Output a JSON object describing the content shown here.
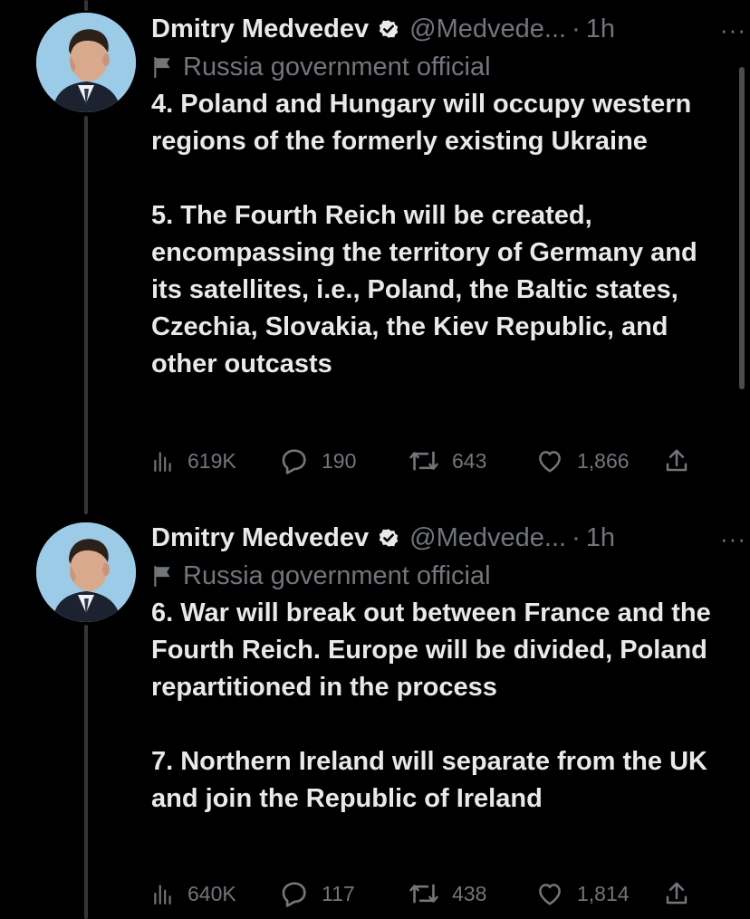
{
  "colors": {
    "background": "#000000",
    "text_primary": "#e7e9ea",
    "text_secondary": "#71767b",
    "verified_badge": "#e7e9ea",
    "thread_line": "#333639"
  },
  "tweets": [
    {
      "author_name": "Dmitry Medvedev",
      "handle": "@Medvede...",
      "separator": "·",
      "time": "1h",
      "more": "···",
      "affiliation": "Russia government official",
      "paragraphs": [
        "4. Poland and Hungary will occupy western regions of the formerly existing Ukraine",
        "5. The Fourth Reich will be created, encompassing the territory of Germany and its satellites, i.e., Poland, the Baltic states, Czechia, Slovakia, the Kiev Republic, and other outcasts"
      ],
      "stats": {
        "views": "619K",
        "replies": "190",
        "retweets": "643",
        "likes": "1,866"
      }
    },
    {
      "author_name": "Dmitry Medvedev",
      "handle": "@Medvede...",
      "separator": "·",
      "time": "1h",
      "more": "···",
      "affiliation": "Russia government official",
      "paragraphs": [
        "6. War will break out between France and the Fourth Reich. Europe will be divided, Poland repartitioned in the process",
        "7. Northern Ireland will separate from the UK and join the Republic of Ireland"
      ],
      "stats": {
        "views": "640K",
        "replies": "117",
        "retweets": "438",
        "likes": "1,814"
      }
    }
  ],
  "icons": {
    "views": "bar-chart-icon",
    "reply": "reply-icon",
    "retweet": "retweet-icon",
    "like": "heart-icon",
    "share": "share-icon",
    "verified": "verified-badge-icon",
    "affiliation": "flag-icon"
  }
}
